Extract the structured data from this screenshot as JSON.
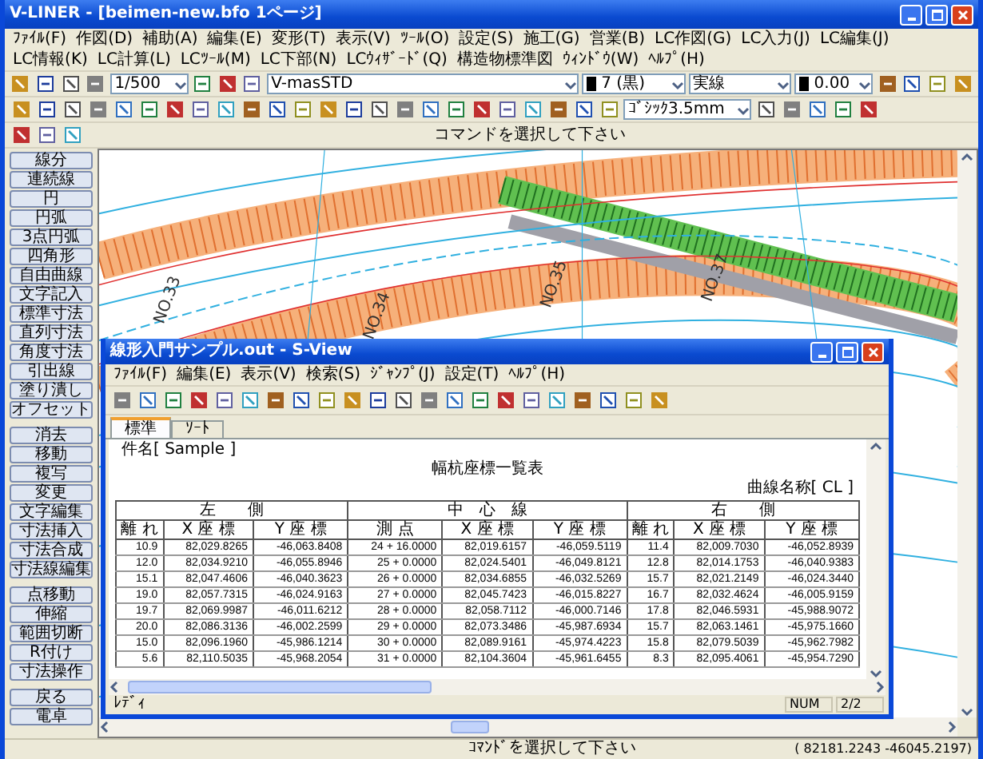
{
  "window": {
    "title": "V-LINER - [beimen-new.bfo 1ページ]"
  },
  "menu": [
    "ﾌｧｲﾙ(F)",
    "作図(D)",
    "補助(A)",
    "編集(E)",
    "変形(T)",
    "表示(V)",
    "ﾂｰﾙ(O)",
    "設定(S)",
    "施工(G)",
    "営業(B)",
    "LC作図(G)",
    "LC入力(J)",
    "LC編集(J)",
    "LC情報(K)",
    "LC計算(L)",
    "LCﾂｰﾙ(M)",
    "LC下部(N)",
    "LCｳｨｻﾞｰﾄﾞ(Q)",
    "構造物標準図",
    "ｳｨﾝﾄﾞｳ(W)",
    "ﾍﾙﾌﾟ(H)"
  ],
  "toolbar": {
    "scale": "1/500",
    "layer": "V-masSTD",
    "pen": "7 (黒)",
    "linetype": "実線",
    "lineweight": "0.00",
    "font": "ｺﾞｼｯｸ3.5mm"
  },
  "prompt": "コマンドを選択して下さい",
  "command_groups": [
    [
      "線分",
      "連続線",
      "円",
      "円弧",
      "3点円弧",
      "四角形",
      "自由曲線",
      "文字記入",
      "標準寸法",
      "直列寸法",
      "角度寸法",
      "引出線",
      "塗り潰し",
      "オフセット"
    ],
    [
      "消去",
      "移動",
      "複写",
      "変更",
      "文字編集",
      "寸法挿入",
      "寸法合成",
      "寸法線編集"
    ],
    [
      "点移動",
      "伸縮",
      "範囲切断",
      "R付け",
      "寸法操作"
    ],
    [
      "戻る",
      "電卓"
    ]
  ],
  "drawing_labels": [
    "NO.33",
    "NO.34",
    "NO.35",
    "NO.37"
  ],
  "sview": {
    "title": "線形入門サンプル.out - S-View",
    "menu": [
      "ﾌｧｲﾙ(F)",
      "編集(E)",
      "表示(V)",
      "検索(S)",
      "ｼﾞｬﾝﾌﾟ(J)",
      "設定(T)",
      "ﾍﾙﾌﾟ(H)"
    ],
    "tabs": [
      {
        "label": "標準",
        "selected": true
      },
      {
        "label": "ｿｰﾄ",
        "selected": false
      }
    ],
    "subject": "件名[ Sample ]",
    "heading": "幅杭座標一覧表",
    "curve": "曲線名称[ CL ]",
    "groups": [
      "左　　側",
      "中　心　線",
      "右　　側"
    ],
    "columns": [
      "離 れ",
      "X 座 標",
      "Y 座 標",
      "測 点",
      "X 座 標",
      "Y 座 標",
      "離 れ",
      "X 座 標",
      "Y 座 標"
    ],
    "rows": [
      [
        "10.9",
        "82,029.8265",
        "-46,063.8408",
        "24 + 16.0000",
        "82,019.6157",
        "-46,059.5119",
        "11.4",
        "82,009.7030",
        "-46,052.8939"
      ],
      [
        "12.0",
        "82,034.9210",
        "-46,055.8946",
        "25 + 0.0000",
        "82,024.5401",
        "-46,049.8121",
        "12.8",
        "82,014.1753",
        "-46,040.9383"
      ],
      [
        "15.1",
        "82,047.4606",
        "-46,040.3623",
        "26 + 0.0000",
        "82,034.6855",
        "-46,032.5269",
        "15.7",
        "82,021.2149",
        "-46,024.3440"
      ],
      [
        "19.0",
        "82,057.7315",
        "-46,024.9163",
        "27 + 0.0000",
        "82,045.7423",
        "-46,015.8227",
        "16.7",
        "82,032.4624",
        "-46,005.9159"
      ],
      [
        "19.7",
        "82,069.9987",
        "-46,011.6212",
        "28 + 0.0000",
        "82,058.7112",
        "-46,000.7146",
        "17.8",
        "82,046.5931",
        "-45,988.9072"
      ],
      [
        "20.0",
        "82,086.3136",
        "-46,002.2599",
        "29 + 0.0000",
        "82,073.3486",
        "-45,987.6934",
        "15.7",
        "82,063.1461",
        "-45,975.1660"
      ],
      [
        "15.0",
        "82,096.1960",
        "-45,986.1214",
        "30 + 0.0000",
        "82,089.9161",
        "-45,974.4223",
        "15.8",
        "82,079.5039",
        "-45,962.7982"
      ],
      [
        "5.6",
        "82,110.5035",
        "-45,968.2054",
        "31 + 0.0000",
        "82,104.3604",
        "-45,961.6455",
        "8.3",
        "82,095.4061",
        "-45,954.7290"
      ]
    ],
    "status": [
      "ﾚﾃﾞｨ",
      "NUM",
      "2/2"
    ]
  },
  "status_bar": {
    "message": "ｺﾏﾝﾄﾞを選択して下さい",
    "coords": "( 82181.2243  -46045.2197)"
  }
}
